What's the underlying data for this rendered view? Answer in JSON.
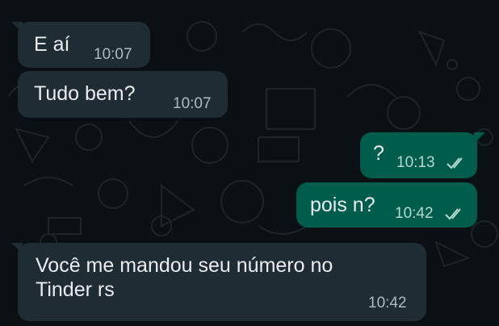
{
  "theme": {
    "background": "#0b1014",
    "incoming_bubble": "#202c33",
    "outgoing_bubble": "#005c4b",
    "text": "#e9edef",
    "doodle": "#1a2226"
  },
  "messages": [
    {
      "direction": "incoming",
      "text": "E aí",
      "time": "10:07"
    },
    {
      "direction": "incoming",
      "text": "Tudo bem?",
      "time": "10:07"
    },
    {
      "direction": "outgoing",
      "text": "?",
      "time": "10:13",
      "status_icon": "double-check-icon"
    },
    {
      "direction": "outgoing",
      "text": "pois n?",
      "time": "10:42",
      "status_icon": "double-check-icon"
    },
    {
      "direction": "incoming",
      "text_line1": "Você me mandou seu número no",
      "text_line2": "Tinder rs",
      "time": "10:42"
    }
  ]
}
